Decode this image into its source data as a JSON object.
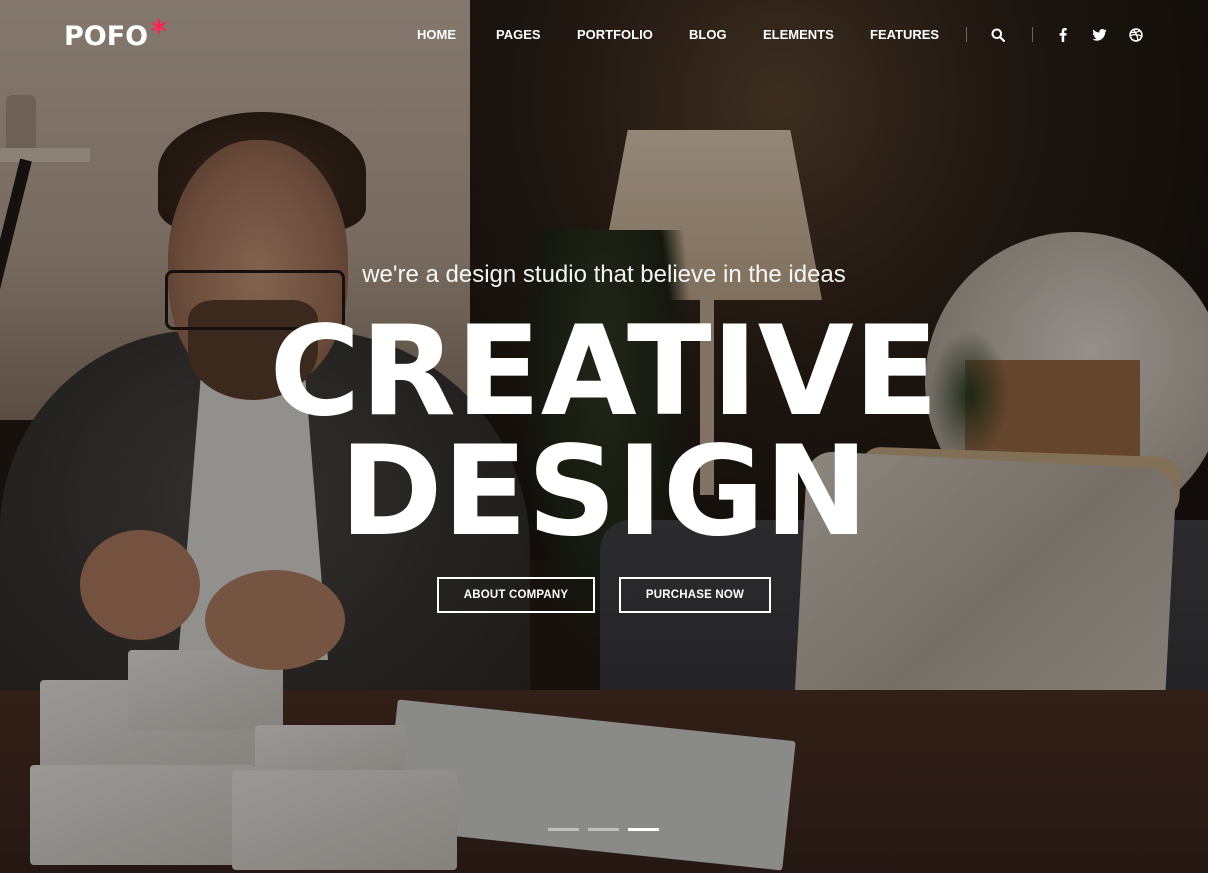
{
  "brand": {
    "name": "POFO",
    "mark": "*",
    "mark_color": "#ff214f"
  },
  "nav": {
    "items": [
      {
        "label": "HOME"
      },
      {
        "label": "PAGES"
      },
      {
        "label": "PORTFOLIO"
      },
      {
        "label": "BLOG"
      },
      {
        "label": "ELEMENTS"
      },
      {
        "label": "FEATURES"
      }
    ],
    "icons": [
      "search-icon",
      "facebook-icon",
      "twitter-icon",
      "dribbble-icon"
    ]
  },
  "hero": {
    "tagline": "we're a design studio that believe in the ideas",
    "title_line_1": "CREATIVE",
    "title_line_2": "DESIGN",
    "buttons": {
      "about": "ABOUT COMPANY",
      "purchase": "PURCHASE NOW"
    },
    "slides": {
      "count": 3,
      "active_index": 2
    }
  },
  "colors": {
    "text": "#ffffff",
    "accent": "#ff214f"
  }
}
